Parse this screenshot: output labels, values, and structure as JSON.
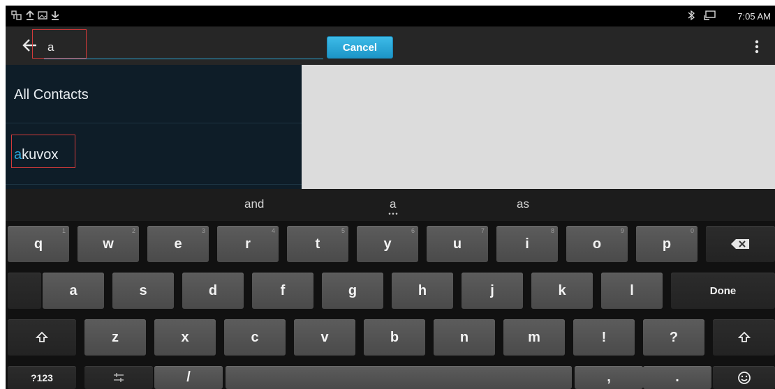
{
  "status_bar": {
    "time": "7:05 AM",
    "icons": [
      "usb-debug-icon",
      "upload-icon",
      "image-icon",
      "download-icon",
      "bluetooth-icon",
      "screen-cast-icon"
    ]
  },
  "search": {
    "query": "a",
    "cancel_label": "Cancel"
  },
  "contacts": {
    "group_label": "All Contacts",
    "result": {
      "highlight": "a",
      "rest": "kuvox"
    }
  },
  "keyboard": {
    "suggestions": [
      "and",
      "a",
      "as"
    ],
    "row1": [
      {
        "label": "q",
        "sup": "1"
      },
      {
        "label": "w",
        "sup": "2"
      },
      {
        "label": "e",
        "sup": "3"
      },
      {
        "label": "r",
        "sup": "4"
      },
      {
        "label": "t",
        "sup": "5"
      },
      {
        "label": "y",
        "sup": "6"
      },
      {
        "label": "u",
        "sup": "7"
      },
      {
        "label": "i",
        "sup": "8"
      },
      {
        "label": "o",
        "sup": "9"
      },
      {
        "label": "p",
        "sup": "0"
      }
    ],
    "row2": [
      "a",
      "s",
      "d",
      "f",
      "g",
      "h",
      "j",
      "k",
      "l"
    ],
    "done_label": "Done",
    "row3": [
      "z",
      "x",
      "c",
      "v",
      "b",
      "n",
      "m",
      "!",
      "?"
    ],
    "row4": {
      "symbols_label": "?123",
      "slash": "/",
      "comma": ",",
      "period": "."
    }
  },
  "colors": {
    "accent": "#29a6dc",
    "cancel_button": "#1c95c7",
    "annotation_box": "#d23a3a"
  }
}
